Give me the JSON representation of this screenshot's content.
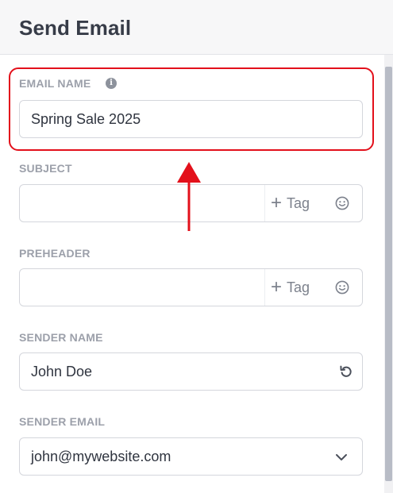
{
  "header": {
    "title": "Send Email"
  },
  "fields": {
    "email_name": {
      "label": "EMAIL NAME",
      "info_icon": "i",
      "value": "Spring Sale 2025"
    },
    "subject": {
      "label": "SUBJECT",
      "value": "",
      "tag_label": "Tag"
    },
    "preheader": {
      "label": "PREHEADER",
      "value": "",
      "tag_label": "Tag"
    },
    "sender_name": {
      "label": "SENDER NAME",
      "value": "John Doe"
    },
    "sender_email": {
      "label": "SENDER EMAIL",
      "value": "john@mywebsite.com"
    }
  },
  "icons": {
    "tag_add": "plus-icon",
    "emoji": "smiley-icon",
    "reset": "undo-icon",
    "dropdown": "chevron-down-icon",
    "info": "info-icon"
  },
  "annotation": {
    "color": "#e3101b",
    "type": "highlight-box-with-arrow"
  },
  "colors": {
    "header_bg": "#f7f7f8",
    "label": "#9ca0aa",
    "border": "#d4d6dc"
  }
}
